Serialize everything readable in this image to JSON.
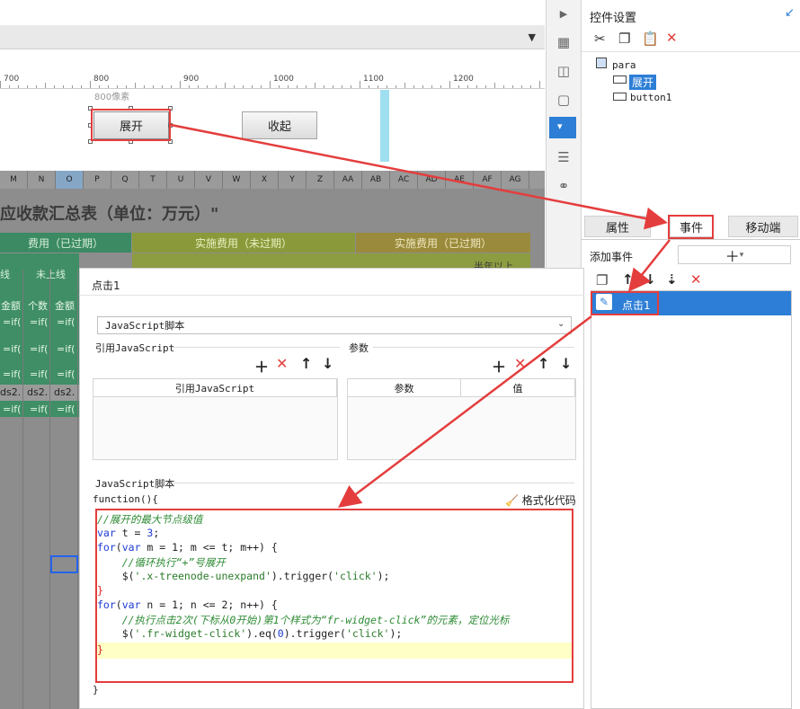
{
  "ruler": {
    "labels": [
      "700",
      "800",
      "900",
      "1000",
      "1100",
      "1200"
    ],
    "pixel_label": "800像素"
  },
  "form": {
    "expand_button": "展开",
    "collapse_button": "收起"
  },
  "sheet": {
    "columns": [
      "M",
      "N",
      "O",
      "P",
      "Q",
      "T",
      "U",
      "V",
      "W",
      "X",
      "Y",
      "Z",
      "AA",
      "AB",
      "AC",
      "AD",
      "AE",
      "AF",
      "AG"
    ],
    "title": "应收款汇总表（单位：万元）\"",
    "band1": "费用（已过期）",
    "band2": "实施费用（未过期）",
    "band3": "实施费用（已过期）",
    "sub1": "线",
    "sub2": "未上线",
    "sub3": "半年以上",
    "row_amount": "金额",
    "row_count": "个数",
    "formula": "=if(",
    "ds": "ds2."
  },
  "panel": {
    "title": "控件设置",
    "tree_root": "para",
    "tree_item_selected": "展开",
    "tree_item2": "button1",
    "tabs": [
      "属性",
      "事件",
      "移动端"
    ],
    "add_event_label": "添加事件",
    "event_item": "点击1"
  },
  "dialog": {
    "title": "点击1",
    "script_type": "JavaScript脚本",
    "ref_js_label": "引用JavaScript",
    "params_label": "参数",
    "col_ref_js": "引用JavaScript",
    "col_param": "参数",
    "col_value": "值",
    "script_label": "JavaScript脚本",
    "function_line": "function(){",
    "format_button": "格式化代码",
    "closing_brace": "}",
    "code": {
      "l1": "//展开的最大节点级值",
      "l2_kw": "var",
      "l2_rest": " t = ",
      "l2_num": "3",
      "l3_kw": "for",
      "l3_mid": "(",
      "l3_kw2": "var",
      "l3_rest": " m = 1; m <= t; m++) {",
      "l4": "    //循环执行“+”号展开",
      "l5_a": "    $(",
      "l5_str": "'.x-treenode-unexpand'",
      "l5_b": ").trigger(",
      "l5_str2": "'click'",
      "l5_c": ");",
      "l6": "}",
      "l7_kw": "for",
      "l7_mid": "(",
      "l7_kw2": "var",
      "l7_rest": " n = 1; n <= 2; n++) {",
      "l8": "    //执行点击2次(下标从0开始)第1个样式为“fr-widget-click”的元素，定位光标",
      "l9_a": "    $(",
      "l9_str": "'.fr-widget-click'",
      "l9_b": ").eq(",
      "l9_num": "0",
      "l9_c": ").trigger(",
      "l9_str2": "'click'",
      "l9_d": ");",
      "l10": "}"
    }
  },
  "colors": {
    "accent": "#2d7ed6",
    "annotation": "#e43d3d",
    "keyword": "#1d3bd4",
    "comment": "#2e8b35"
  },
  "icons": [
    "cut-icon",
    "copy-icon",
    "paste-icon",
    "delete-icon",
    "add-icon",
    "move-up-icon",
    "move-down-icon",
    "format-broom-icon",
    "edit-pen-icon"
  ]
}
